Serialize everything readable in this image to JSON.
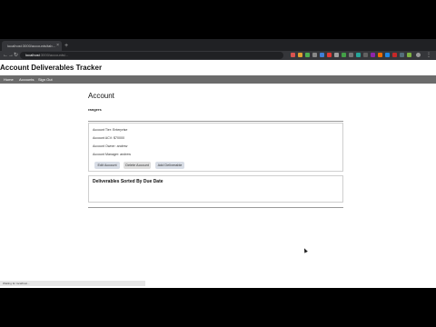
{
  "browser": {
    "tab_title": "localhost:3000/accounts/tab...",
    "url_host": "localhost",
    "url_rest": ":3000/accounts/...",
    "back_icon": "arrow-left-icon",
    "forward_icon": "arrow-right-icon",
    "reload_icon": "reload-icon",
    "new_tab_glyph": "+",
    "close_glyph": "×"
  },
  "app": {
    "title": "Account Deliverables Tracker",
    "nav": [
      "Home",
      "Accounts",
      "Sign Out"
    ]
  },
  "page": {
    "heading": "Account",
    "account_name": "rangers"
  },
  "details": {
    "tier": "Account Tier: Enterprise",
    "acv": "Account ACV: $70000",
    "owner": "Account Owner: andrew",
    "manager": "Account Manager: andrew"
  },
  "buttons": {
    "edit": "Edit Account",
    "delete": "Delete Account",
    "add": "Add Deliverable"
  },
  "deliverables": {
    "heading": "Deliverables Sorted By Due Date"
  },
  "status": {
    "text": "Waiting for localhost..."
  },
  "colors": {
    "nav_bg": "#6b6b6b",
    "chrome_dark": "#202124"
  }
}
